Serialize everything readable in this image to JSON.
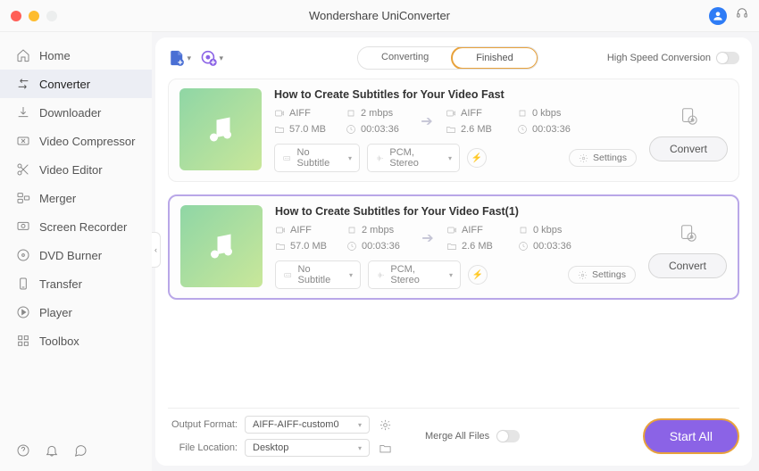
{
  "app_title": "Wondershare UniConverter",
  "sidebar": {
    "items": [
      {
        "id": "home",
        "label": "Home"
      },
      {
        "id": "converter",
        "label": "Converter"
      },
      {
        "id": "downloader",
        "label": "Downloader"
      },
      {
        "id": "video-compressor",
        "label": "Video Compressor"
      },
      {
        "id": "video-editor",
        "label": "Video Editor"
      },
      {
        "id": "merger",
        "label": "Merger"
      },
      {
        "id": "screen-recorder",
        "label": "Screen Recorder"
      },
      {
        "id": "dvd-burner",
        "label": "DVD Burner"
      },
      {
        "id": "transfer",
        "label": "Transfer"
      },
      {
        "id": "player",
        "label": "Player"
      },
      {
        "id": "toolbox",
        "label": "Toolbox"
      }
    ]
  },
  "tabs": {
    "converting": "Converting",
    "finished": "Finished"
  },
  "hsc_label": "High Speed Conversion",
  "cards": [
    {
      "title": "How to Create Subtitles for Your Video Fast",
      "src": {
        "format": "AIFF",
        "bitrate": "2 mbps",
        "size": "57.0 MB",
        "duration": "00:03:36"
      },
      "dst": {
        "format": "AIFF",
        "bitrate": "0 kbps",
        "size": "2.6 MB",
        "duration": "00:03:36"
      },
      "subtitle": "No Subtitle",
      "audio": "PCM, Stereo",
      "settings_label": "Settings",
      "convert_label": "Convert"
    },
    {
      "title": "How to Create Subtitles for Your Video Fast(1)",
      "src": {
        "format": "AIFF",
        "bitrate": "2 mbps",
        "size": "57.0 MB",
        "duration": "00:03:36"
      },
      "dst": {
        "format": "AIFF",
        "bitrate": "0 kbps",
        "size": "2.6 MB",
        "duration": "00:03:36"
      },
      "subtitle": "No Subtitle",
      "audio": "PCM, Stereo",
      "settings_label": "Settings",
      "convert_label": "Convert"
    }
  ],
  "bottom": {
    "output_format_label": "Output Format:",
    "output_format_value": "AIFF-AIFF-custom0",
    "file_location_label": "File Location:",
    "file_location_value": "Desktop",
    "merge_label": "Merge All Files",
    "start_all_label": "Start All"
  }
}
